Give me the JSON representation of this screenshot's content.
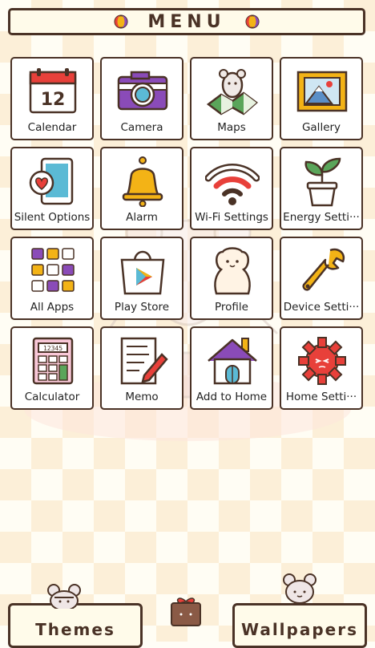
{
  "header": {
    "title": "MENU"
  },
  "apps": [
    {
      "label": "Calendar",
      "icon": "calendar-icon",
      "date": "12"
    },
    {
      "label": "Camera",
      "icon": "camera-icon"
    },
    {
      "label": "Maps",
      "icon": "maps-icon"
    },
    {
      "label": "Gallery",
      "icon": "gallery-icon"
    },
    {
      "label": "Silent Options",
      "icon": "silent-options-icon"
    },
    {
      "label": "Alarm",
      "icon": "bell-icon"
    },
    {
      "label": "Wi-Fi Settings",
      "icon": "wifi-icon"
    },
    {
      "label": "Energy Setti···",
      "icon": "plant-icon"
    },
    {
      "label": "All Apps",
      "icon": "all-apps-icon"
    },
    {
      "label": "Play Store",
      "icon": "play-store-icon"
    },
    {
      "label": "Profile",
      "icon": "profile-icon"
    },
    {
      "label": "Device Setti···",
      "icon": "wrench-icon"
    },
    {
      "label": "Calculator",
      "icon": "calculator-icon",
      "display": "12345"
    },
    {
      "label": "Memo",
      "icon": "memo-icon"
    },
    {
      "label": "Add to Home",
      "icon": "house-icon"
    },
    {
      "label": "Home Setti···",
      "icon": "gear-icon"
    }
  ],
  "bottom": {
    "themes_label": "Themes",
    "wallpapers_label": "Wallpapers"
  },
  "colors": {
    "outline": "#4a3226",
    "accent_red": "#e8403a",
    "accent_purple": "#8a4bb8",
    "accent_yellow": "#f3b316"
  }
}
